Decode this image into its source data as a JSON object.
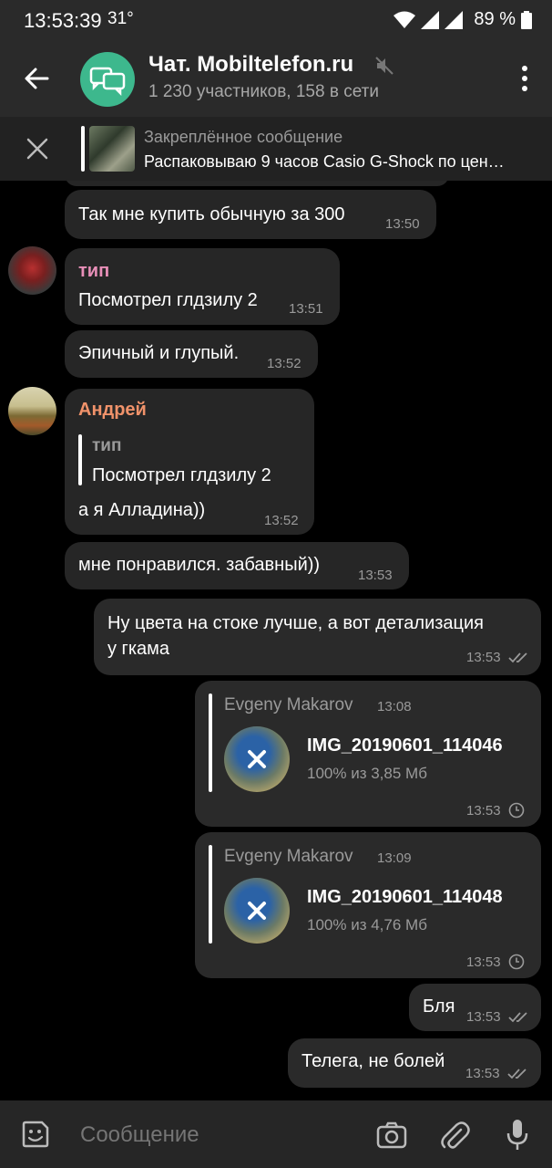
{
  "status_bar": {
    "time": "13:53:39",
    "temperature": "31°",
    "battery": "89 %",
    "icons": [
      "wifi-icon",
      "signal-icon",
      "signal-icon",
      "battery-icon"
    ]
  },
  "header": {
    "title": "Чат. Mobiltelefon.ru",
    "subtitle": "1 230 участников, 158 в сети",
    "avatar_color": "#3db88d"
  },
  "pinned": {
    "label": "Закреплённое сообщение",
    "text": "Распаковываю 9 часов Casio G-Shock по цен…"
  },
  "messages": [
    {
      "direction": "in",
      "text": "Так мне купить обычную за 300",
      "time": "13:50"
    },
    {
      "direction": "in",
      "sender": "тип",
      "sender_color": "#e88fb8",
      "text": "Посмотрел глдзилу 2",
      "time": "13:51"
    },
    {
      "direction": "in",
      "text": "Эпичный и глупый.",
      "time": "13:52"
    },
    {
      "direction": "in",
      "sender": "Андрей",
      "sender_color": "#f0926a",
      "reply_to": {
        "name": "тип",
        "text": "Посмотрел глдзилу 2"
      },
      "text": "а я Алладина))",
      "time": "13:52"
    },
    {
      "direction": "in",
      "text": "мне понравился. забавный))",
      "time": "13:53"
    },
    {
      "direction": "out",
      "text_line1": "Ну цвета на стоке лучше, а вот детализация",
      "text_line2": "у гкама",
      "time": "13:53",
      "status": "read"
    },
    {
      "direction": "out",
      "forwarded_from": "Evgeny Makarov",
      "forwarded_time": "13:08",
      "file_name": "IMG_20190601_114046",
      "file_size": "100% из 3,85 Мб",
      "time": "13:53",
      "status": "pending"
    },
    {
      "direction": "out",
      "forwarded_from": "Evgeny Makarov",
      "forwarded_time": "13:09",
      "file_name": "IMG_20190601_114048",
      "file_size": "100% из 4,76 Мб",
      "time": "13:53",
      "status": "pending"
    },
    {
      "direction": "out",
      "text": "Бля",
      "time": "13:53",
      "status": "read"
    },
    {
      "direction": "out",
      "text": "Телега, не болей",
      "time": "13:53",
      "status": "read"
    }
  ],
  "input": {
    "placeholder": "Сообщение"
  }
}
